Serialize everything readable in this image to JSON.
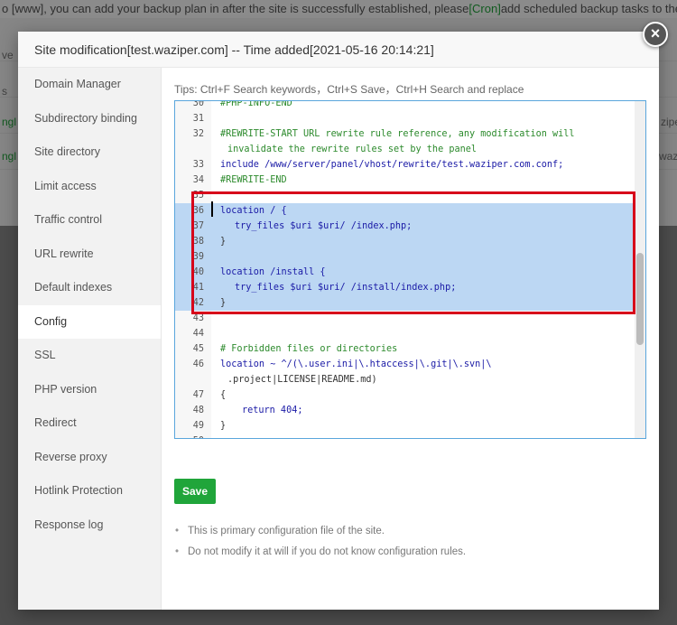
{
  "background": {
    "banner_prefix": "o [www], you can add your backup plan in after the site is successfully established, please",
    "banner_link": "[Cron]",
    "banner_suffix": "add scheduled backup tasks to the page!",
    "left_edge_1": "ve",
    "left_edge_2": "s",
    "right_edge_1": "ziper",
    "right_edge_2": "wazipe",
    "left_green_1": "ngl",
    "left_green_2": "ngl"
  },
  "modal": {
    "title": "Site modification[test.waziper.com] -- Time added[2021-05-16 20:14:21]",
    "close_icon": "×"
  },
  "sidebar": {
    "items": [
      {
        "label": "Domain Manager"
      },
      {
        "label": "Subdirectory binding"
      },
      {
        "label": "Site directory"
      },
      {
        "label": "Limit access"
      },
      {
        "label": "Traffic control"
      },
      {
        "label": "URL rewrite"
      },
      {
        "label": "Default indexes"
      },
      {
        "label": "Config"
      },
      {
        "label": "SSL"
      },
      {
        "label": "PHP version"
      },
      {
        "label": "Redirect"
      },
      {
        "label": "Reverse proxy"
      },
      {
        "label": "Hotlink Protection"
      },
      {
        "label": "Response log"
      }
    ],
    "active": "Config"
  },
  "content": {
    "tips": "Tips: Ctrl+F Search keywords，Ctrl+S Save，Ctrl+H Search and replace",
    "save_label": "Save",
    "notes": [
      "This is primary configuration file of the site.",
      "Do not modify it at will if you do not know configuration rules."
    ]
  },
  "editor": {
    "lines": [
      {
        "n": "30",
        "t": "#PHP-INFO-END",
        "c": "comment",
        "indent": 0
      },
      {
        "n": "31",
        "t": "",
        "c": "plain",
        "indent": 0
      },
      {
        "n": "32",
        "t": "#REWRITE-START URL rewrite rule reference, any modification will",
        "c": "comment",
        "indent": 0
      },
      {
        "n": "",
        "t": "invalidate the rewrite rules set by the panel",
        "c": "comment",
        "indent": 1
      },
      {
        "n": "33",
        "t": "include /www/server/panel/vhost/rewrite/test.waziper.com.conf;",
        "c": "include",
        "indent": 0
      },
      {
        "n": "34",
        "t": "#REWRITE-END",
        "c": "comment",
        "indent": 0
      },
      {
        "n": "35",
        "t": "",
        "c": "plain",
        "indent": 0
      },
      {
        "n": "36",
        "t": "location / {",
        "c": "key",
        "indent": 0,
        "sel": true
      },
      {
        "n": "37",
        "t": "try_files $uri $uri/ /index.php;",
        "c": "try",
        "indent": 2,
        "sel": true
      },
      {
        "n": "38",
        "t": "}",
        "c": "plain",
        "indent": 0,
        "sel": true
      },
      {
        "n": "39",
        "t": "",
        "c": "plain",
        "indent": 0,
        "sel": true
      },
      {
        "n": "40",
        "t": "location /install {",
        "c": "key",
        "indent": 0,
        "sel": true
      },
      {
        "n": "41",
        "t": "try_files $uri $uri/ /install/index.php;",
        "c": "try",
        "indent": 2,
        "sel": true
      },
      {
        "n": "42",
        "t": "}",
        "c": "plain",
        "indent": 0,
        "sel": true
      },
      {
        "n": "43",
        "t": "",
        "c": "plain",
        "indent": 0
      },
      {
        "n": "44",
        "t": "",
        "c": "plain",
        "indent": 0
      },
      {
        "n": "45",
        "t": "# Forbidden files or directories",
        "c": "comment",
        "indent": 0
      },
      {
        "n": "46",
        "t": "location ~ ^/(\\.user.ini|\\.htaccess|\\.git|\\.svn|\\",
        "c": "key",
        "indent": 0
      },
      {
        "n": "",
        "t": ".project|LICENSE|README.md)",
        "c": "plain",
        "indent": 1
      },
      {
        "n": "47",
        "t": "{",
        "c": "plain",
        "indent": 0
      },
      {
        "n": "48",
        "t": "return 404;",
        "c": "return",
        "indent": 3
      },
      {
        "n": "49",
        "t": "}",
        "c": "plain",
        "indent": 0
      },
      {
        "n": "50",
        "t": "",
        "c": "plain",
        "indent": 0
      }
    ]
  }
}
